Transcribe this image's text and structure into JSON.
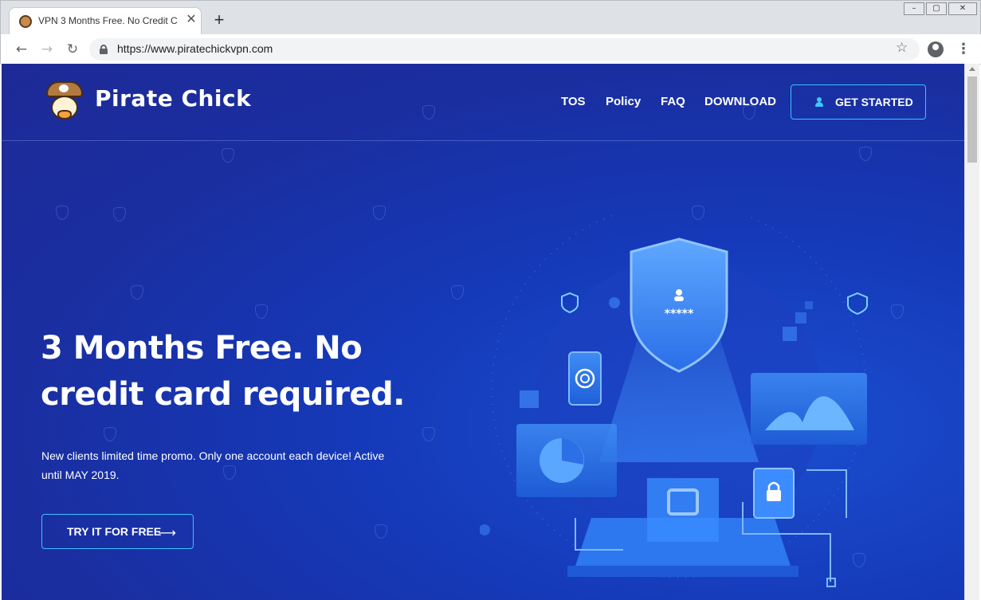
{
  "browser": {
    "tab_title": "VPN 3 Months Free. No Credit C",
    "url": "https://www.piratechickvpn.com",
    "new_tab": "+",
    "close": "✕"
  },
  "site": {
    "brand": "Pirate Chick",
    "nav": [
      "TOS",
      "Policy",
      "FAQ",
      "DOWNLOAD"
    ],
    "cta": "GET STARTED"
  },
  "hero": {
    "title_line1": "3 Months Free. No",
    "title_line2": "credit card required.",
    "subtitle": "New clients limited time promo. Only one account each device! Active until MAY 2019.",
    "button": "TRY IT FOR FREE"
  },
  "illustration": {
    "password_mask": "*****"
  },
  "colors": {
    "background": "#1a2ea0",
    "accent": "#36c6ff",
    "text": "#ffffff"
  }
}
